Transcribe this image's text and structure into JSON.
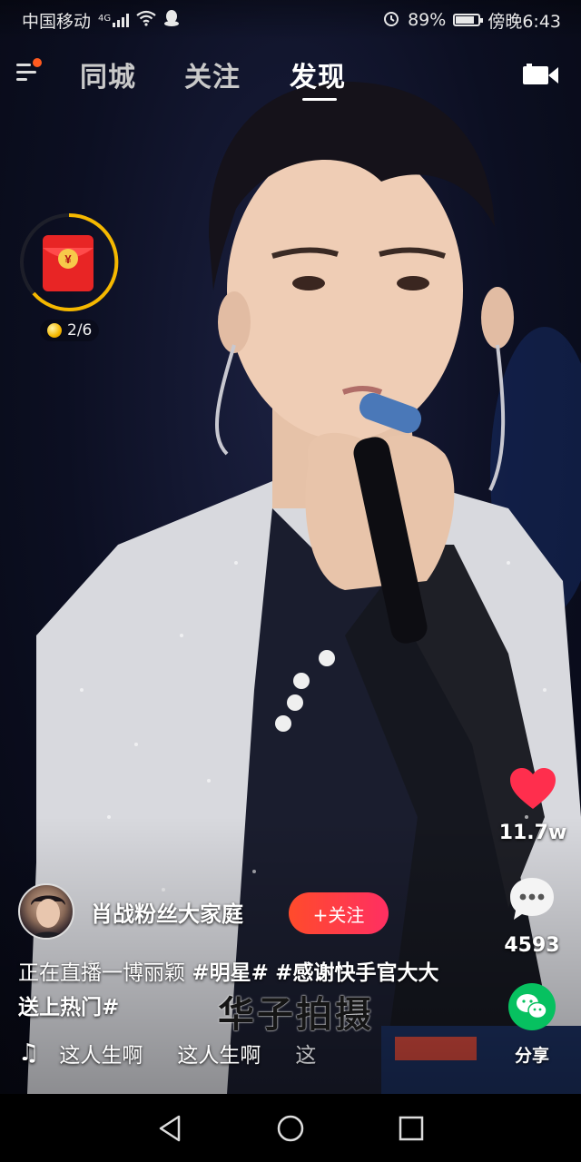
{
  "status_bar": {
    "carrier": "中国移动",
    "network": "4G",
    "battery": "89%",
    "battery_level": 0.89,
    "time": "傍晚6:43"
  },
  "top_nav": {
    "tabs": [
      {
        "label": "同城",
        "active": false
      },
      {
        "label": "关注",
        "active": false
      },
      {
        "label": "发现",
        "active": true
      }
    ],
    "menu_icon": "hamburger-menu-icon",
    "camera_icon": "camera-icon"
  },
  "red_packet": {
    "progress": "2/6",
    "icon": "red-envelope-icon"
  },
  "actions": {
    "like_count": "11.7w",
    "comment_count": "4593",
    "share_label": "分享"
  },
  "post": {
    "author": "肖战粉丝大家庭",
    "follow_label": "+关注",
    "caption_plain": "正在直播一博丽颖 ",
    "caption_tag1": "#明星#",
    "caption_tag2": "#感谢快手官大大送上热门#",
    "music_text_1": "这人生啊",
    "music_text_2": "这人生啊",
    "music_text_3": "这",
    "watermark": "华子拍摄"
  },
  "colors": {
    "accent_red": "#ff3355",
    "follow_button": "#ff4b2b",
    "like_heart": "#ff2e4d",
    "wechat_green": "#07c160",
    "red_packet_ring": "#f5b800"
  }
}
